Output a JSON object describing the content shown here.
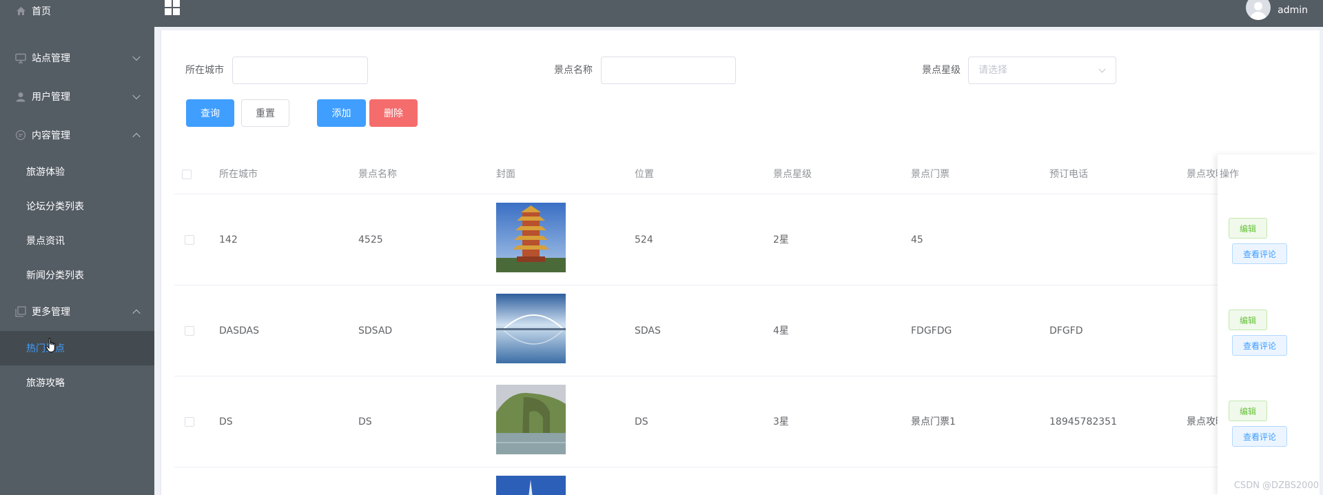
{
  "sidebar": {
    "home": "首页",
    "site_mgmt": "站点管理",
    "user_mgmt": "用户管理",
    "content_mgmt": "内容管理",
    "content_items": [
      "旅游体验",
      "论坛分类列表",
      "景点资讯",
      "新闻分类列表"
    ],
    "more_mgmt": "更多管理",
    "more_items": [
      "热门景点",
      "旅游攻略"
    ],
    "active_item": "热门景点"
  },
  "header": {
    "username": "admin"
  },
  "search": {
    "city_label": "所在城市",
    "city_value": "",
    "name_label": "景点名称",
    "name_value": "",
    "level_label": "景点星级",
    "level_placeholder": "请选择"
  },
  "buttons": {
    "query": "查询",
    "reset": "重置",
    "add": "添加",
    "delete": "删除"
  },
  "table": {
    "columns": [
      "所在城市",
      "景点名称",
      "封面",
      "位置",
      "景点星级",
      "景点门票",
      "预订电话",
      "景点攻略",
      "操作"
    ],
    "rows": [
      {
        "city": "142",
        "name": "4525",
        "location": "524",
        "level": "2星",
        "ticket": "45",
        "phone": "",
        "guide": ""
      },
      {
        "city": "DASDAS",
        "name": "SDSAD",
        "location": "SDAS",
        "level": "4星",
        "ticket": "FDGFDG",
        "phone": "DFGFD",
        "guide": ""
      },
      {
        "city": "DS",
        "name": "DS",
        "location": "DS",
        "level": "3星",
        "ticket": "景点门票1",
        "phone": "18945782351",
        "guide": "景点攻略"
      }
    ],
    "edit_label": "编辑",
    "view_comments_label": "查看评论"
  },
  "watermark": "CSDN @DZBS2000",
  "colors": {
    "sidebar_bg": "#545c64",
    "primary": "#409eff",
    "danger": "#f56c6c",
    "success": "#67c23a"
  }
}
